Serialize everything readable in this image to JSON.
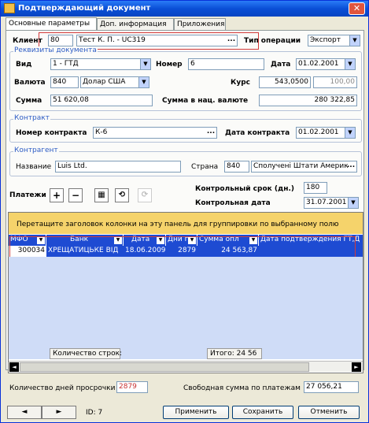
{
  "window": {
    "title": "Подтверждающий документ",
    "close_glyph": "✕"
  },
  "tabs": [
    "Основные параметры",
    "Доп. информация",
    "Приложения"
  ],
  "client": {
    "label": "Клиент",
    "code": "80",
    "name": "Тест К. П. - UC319",
    "ellipsis": "..."
  },
  "operation": {
    "label": "Тип операции",
    "value": "Экспорт"
  },
  "doc_group": {
    "title": "Реквизиты документа",
    "kind_label": "Вид",
    "kind_value": "1 - ГТД",
    "number_label": "Номер",
    "number_value": "6",
    "date_label": "Дата",
    "date_value": "01.02.2001",
    "currency_label": "Валюта",
    "currency_code": "840",
    "currency_name": "Долар США",
    "rate_label": "Курс",
    "rate_value": "543,0500",
    "rate_units": "100,00",
    "amount_label": "Сумма",
    "amount_value": "51 620,08",
    "amount_nat_label": "Сумма в нац. валюте",
    "amount_nat_value": "280 322,85"
  },
  "contract_group": {
    "title": "Контракт",
    "number_label": "Номер контракта",
    "number_value": "К-6",
    "date_label": "Дата контракта",
    "date_value": "01.02.2001"
  },
  "counterparty_group": {
    "title": "Контрагент",
    "name_label": "Название",
    "name_value": "Luis Ltd.",
    "country_label": "Страна",
    "country_code": "840",
    "country_name": "Сполучені Штати Америк"
  },
  "payments": {
    "label": "Платежи",
    "toolbar": [
      {
        "name": "add-icon",
        "glyph": "+"
      },
      {
        "name": "remove-icon",
        "glyph": "−"
      },
      {
        "name": "grid-select-icon",
        "glyph": "▦"
      },
      {
        "name": "link-icon",
        "glyph": "⟲"
      },
      {
        "name": "unlink-icon",
        "glyph": "⟳"
      }
    ]
  },
  "control": {
    "term_label": "Контрольный срок (дн.)",
    "term_value": "180",
    "date_label": "Контрольная дата",
    "date_value": "31.07.2001"
  },
  "grid": {
    "group_hint": "Перетащите заголовок колонки на эту панель для группировки по выбранному полю",
    "columns": [
      "МФО",
      "Банк",
      "Дата",
      "Дни г",
      "Сумма опл",
      "Дата подтверждения ГТ,Д"
    ],
    "rows": [
      [
        "300034",
        "ХРЕЩАТИЦЬКЕ ВІД",
        "18.06.2009",
        "2879",
        "24 563,87",
        ""
      ]
    ],
    "footer_count": "Количество строк:",
    "footer_total": "Итого: 24 56"
  },
  "bottom": {
    "overdue_label": "Количество дней просрочки",
    "overdue_value": "2879",
    "free_label": "Свободная сумма по платежам",
    "free_value": "27 056,21"
  },
  "footerbar": {
    "prev": "◄",
    "next": "►",
    "id_label": "ID: 7",
    "apply": "Применить",
    "save": "Сохранить",
    "cancel": "Отменить"
  },
  "colors": {
    "accent": "#1e4bd2",
    "highlight": "#d23a3a",
    "hint_bg": "#f5d36b"
  }
}
